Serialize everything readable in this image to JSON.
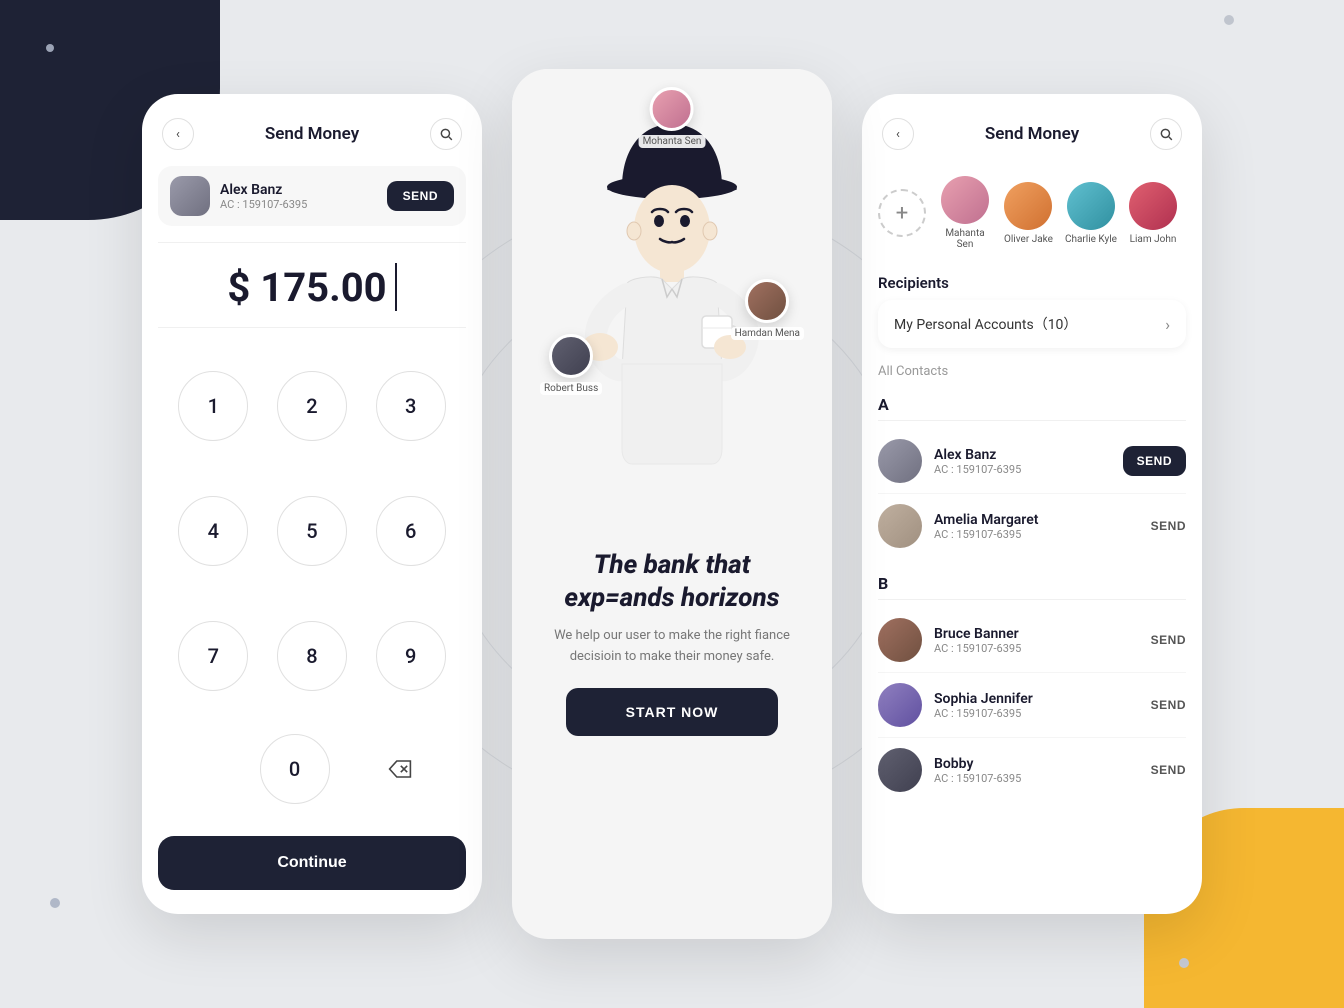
{
  "background": {
    "accent_yellow": "#f5b731",
    "accent_dark": "#1e2235"
  },
  "card1": {
    "title": "Send Money",
    "recipient": {
      "name": "Alex Banz",
      "account": "AC : 159107-6395",
      "send_label": "SEND"
    },
    "amount": "$ 175.00",
    "keys": [
      "1",
      "2",
      "3",
      "4",
      "5",
      "6",
      "7",
      "8",
      "9",
      "0"
    ],
    "continue_label": "Continue"
  },
  "card2": {
    "title": "The bank that exp=ands horizons",
    "subtitle": "We help our user to make the right fiance decisioin to make their money safe.",
    "cta": "START NOW",
    "avatars": [
      {
        "name": "Mohanta Sen",
        "pos": "top"
      },
      {
        "name": "Robert Buss",
        "pos": "left"
      },
      {
        "name": "Hamdan Mena",
        "pos": "right"
      }
    ]
  },
  "card3": {
    "title": "Send Money",
    "personal_accounts": "My Personal Accounts（10）",
    "all_contacts": "All Contacts",
    "quick_contacts": [
      {
        "name": "Mahanta Sen"
      },
      {
        "name": "Oliver Jake"
      },
      {
        "name": "Charlie Kyle"
      },
      {
        "name": "Liam John"
      }
    ],
    "sections": [
      {
        "letter": "A",
        "contacts": [
          {
            "name": "Alex Banz",
            "account": "AC : 159107-6395",
            "send": "SEND",
            "active": true
          },
          {
            "name": "Amelia Margaret",
            "account": "AC : 159107-6395",
            "send": "SEND",
            "active": false
          }
        ]
      },
      {
        "letter": "B",
        "contacts": [
          {
            "name": "Bruce Banner",
            "account": "AC : 159107-6395",
            "send": "SEND",
            "active": false
          },
          {
            "name": "Sophia Jennifer",
            "account": "AC : 159107-6395",
            "send": "SEND",
            "active": false
          },
          {
            "name": "Bobby",
            "account": "AC : 159107-6395",
            "send": "SEND",
            "active": false
          }
        ]
      }
    ]
  }
}
